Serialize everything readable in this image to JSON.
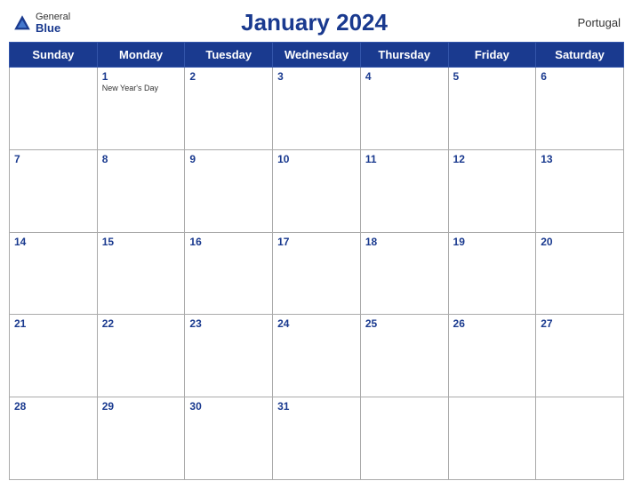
{
  "header": {
    "logo_general": "General",
    "logo_blue": "Blue",
    "title": "January 2024",
    "country": "Portugal"
  },
  "days": [
    "Sunday",
    "Monday",
    "Tuesday",
    "Wednesday",
    "Thursday",
    "Friday",
    "Saturday"
  ],
  "weeks": [
    [
      {
        "day": "",
        "holiday": ""
      },
      {
        "day": "1",
        "holiday": "New Year's Day"
      },
      {
        "day": "2",
        "holiday": ""
      },
      {
        "day": "3",
        "holiday": ""
      },
      {
        "day": "4",
        "holiday": ""
      },
      {
        "day": "5",
        "holiday": ""
      },
      {
        "day": "6",
        "holiday": ""
      }
    ],
    [
      {
        "day": "7",
        "holiday": ""
      },
      {
        "day": "8",
        "holiday": ""
      },
      {
        "day": "9",
        "holiday": ""
      },
      {
        "day": "10",
        "holiday": ""
      },
      {
        "day": "11",
        "holiday": ""
      },
      {
        "day": "12",
        "holiday": ""
      },
      {
        "day": "13",
        "holiday": ""
      }
    ],
    [
      {
        "day": "14",
        "holiday": ""
      },
      {
        "day": "15",
        "holiday": ""
      },
      {
        "day": "16",
        "holiday": ""
      },
      {
        "day": "17",
        "holiday": ""
      },
      {
        "day": "18",
        "holiday": ""
      },
      {
        "day": "19",
        "holiday": ""
      },
      {
        "day": "20",
        "holiday": ""
      }
    ],
    [
      {
        "day": "21",
        "holiday": ""
      },
      {
        "day": "22",
        "holiday": ""
      },
      {
        "day": "23",
        "holiday": ""
      },
      {
        "day": "24",
        "holiday": ""
      },
      {
        "day": "25",
        "holiday": ""
      },
      {
        "day": "26",
        "holiday": ""
      },
      {
        "day": "27",
        "holiday": ""
      }
    ],
    [
      {
        "day": "28",
        "holiday": ""
      },
      {
        "day": "29",
        "holiday": ""
      },
      {
        "day": "30",
        "holiday": ""
      },
      {
        "day": "31",
        "holiday": ""
      },
      {
        "day": "",
        "holiday": ""
      },
      {
        "day": "",
        "holiday": ""
      },
      {
        "day": "",
        "holiday": ""
      }
    ]
  ]
}
